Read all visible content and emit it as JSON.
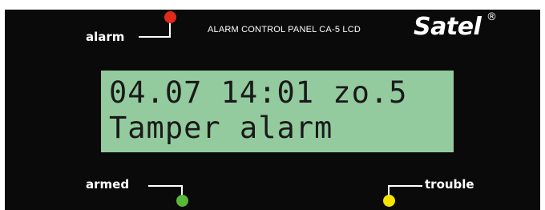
{
  "panel": {
    "model_text": "ALARM CONTROL PANEL CA-5 LCD",
    "brand": "Satel",
    "brand_mark": "®"
  },
  "display": {
    "line1": "04.07 14:01 zo.5",
    "line2": "Tamper alarm",
    "background_color": "#93cb9e"
  },
  "indicators": {
    "alarm": {
      "label": "alarm",
      "led_color": "#e02a1a"
    },
    "armed": {
      "label": "armed",
      "led_color": "#57b83a"
    },
    "trouble": {
      "label": "trouble",
      "led_color": "#f4e400"
    }
  }
}
